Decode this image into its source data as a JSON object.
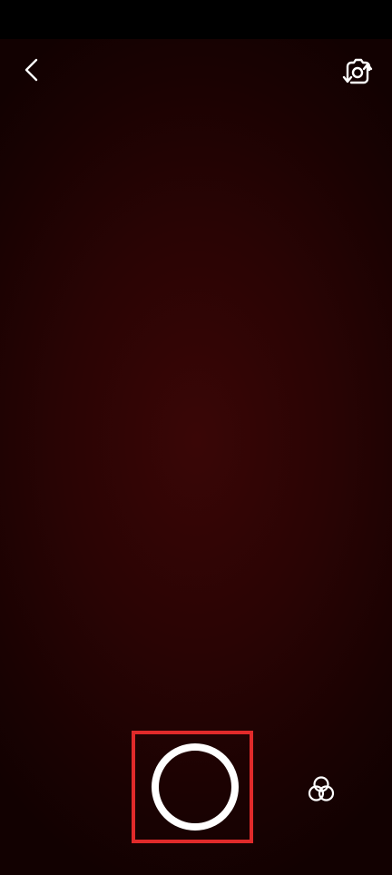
{
  "screen": {
    "name": "camera-capture"
  },
  "icons": {
    "back": "chevron-left-icon",
    "flip_camera": "camera-flip-icon",
    "effects": "filters-icon"
  },
  "colors": {
    "shutter_ring": "#ffffff",
    "highlight_box": "#e02a2a",
    "viewfinder_center": "#3a0606",
    "viewfinder_edge": "#120101",
    "status_bar": "#000000"
  }
}
